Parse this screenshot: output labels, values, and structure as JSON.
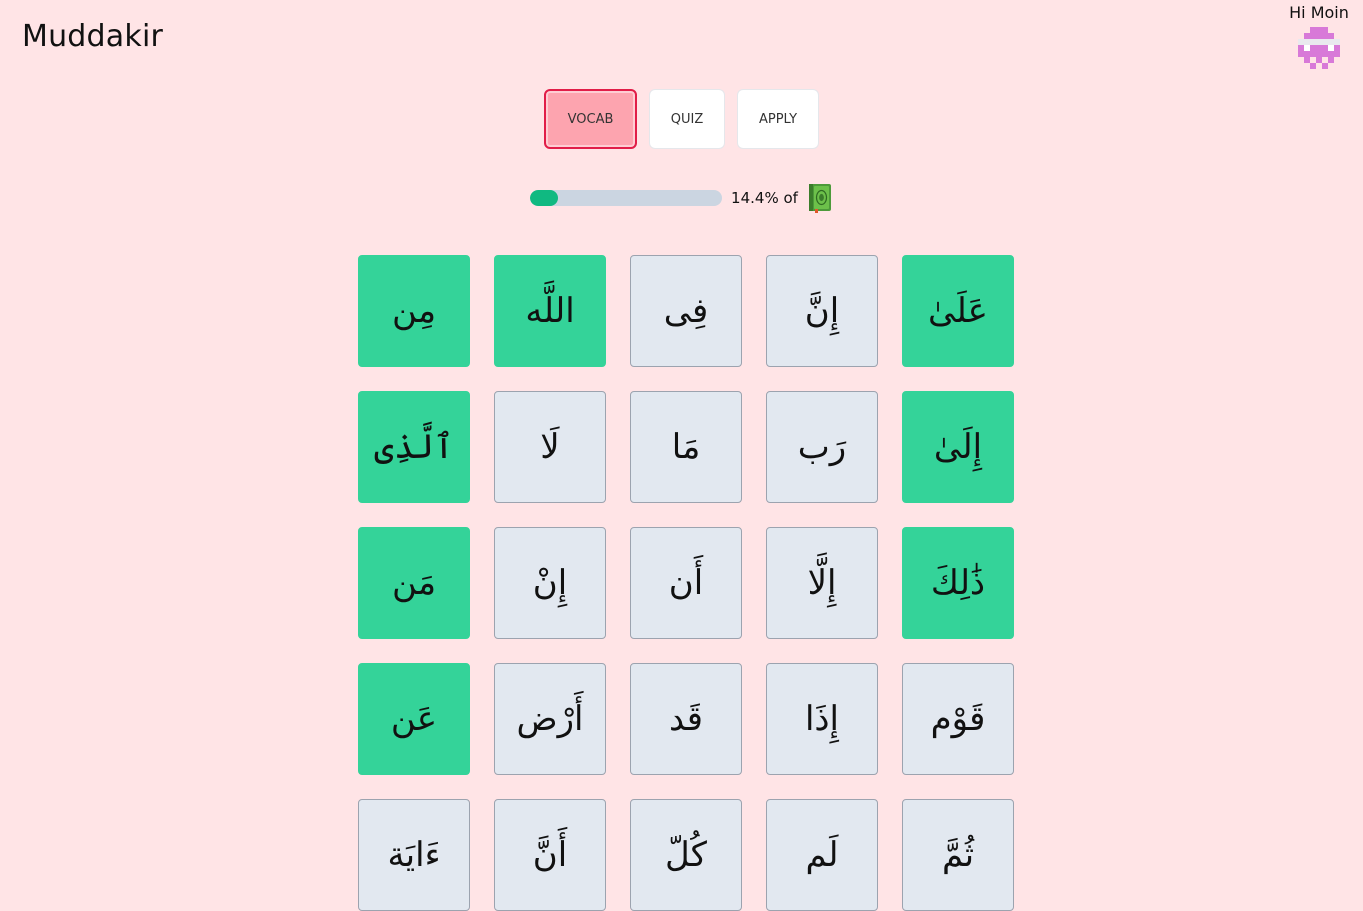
{
  "header": {
    "app_title": "Muddakir",
    "greeting": "Hi Moin",
    "avatar_icon": "pixel-invader-avatar",
    "avatar_color": "#d879d8"
  },
  "tabs": [
    {
      "label": "VOCAB",
      "active": true
    },
    {
      "label": "QUIZ",
      "active": false
    },
    {
      "label": "APPLY",
      "active": false
    }
  ],
  "progress": {
    "percent": 14.4,
    "label": "14.4% of",
    "icon": "quran-book-icon",
    "fill_color": "#10b981",
    "track_color": "#cbd5e1"
  },
  "colors": {
    "background": "#ffe4e6",
    "known_word": "#34d399",
    "unknown_word": "#e2e8f0",
    "active_tab": "#fda4af"
  },
  "words": [
    {
      "text": "مِن",
      "known": true
    },
    {
      "text": "اللَّه",
      "known": true
    },
    {
      "text": "فِى",
      "known": false
    },
    {
      "text": "إِنَّ",
      "known": false
    },
    {
      "text": "عَلَىٰ",
      "known": true
    },
    {
      "text": "ٱلَّذِى",
      "known": true
    },
    {
      "text": "لَا",
      "known": false
    },
    {
      "text": "مَا",
      "known": false
    },
    {
      "text": "رَب",
      "known": false
    },
    {
      "text": "إِلَىٰ",
      "known": true
    },
    {
      "text": "مَن",
      "known": true
    },
    {
      "text": "إِنْ",
      "known": false
    },
    {
      "text": "أَن",
      "known": false
    },
    {
      "text": "إِلَّا",
      "known": false
    },
    {
      "text": "ذَٰلِكَ",
      "known": true
    },
    {
      "text": "عَن",
      "known": true
    },
    {
      "text": "أَرْض",
      "known": false
    },
    {
      "text": "قَد",
      "known": false
    },
    {
      "text": "إِذَا",
      "known": false
    },
    {
      "text": "قَوْم",
      "known": false
    },
    {
      "text": "ءَايَة",
      "known": false
    },
    {
      "text": "أَنَّ",
      "known": false
    },
    {
      "text": "كُلّ",
      "known": false
    },
    {
      "text": "لَم",
      "known": false
    },
    {
      "text": "ثُمَّ",
      "known": false
    }
  ]
}
